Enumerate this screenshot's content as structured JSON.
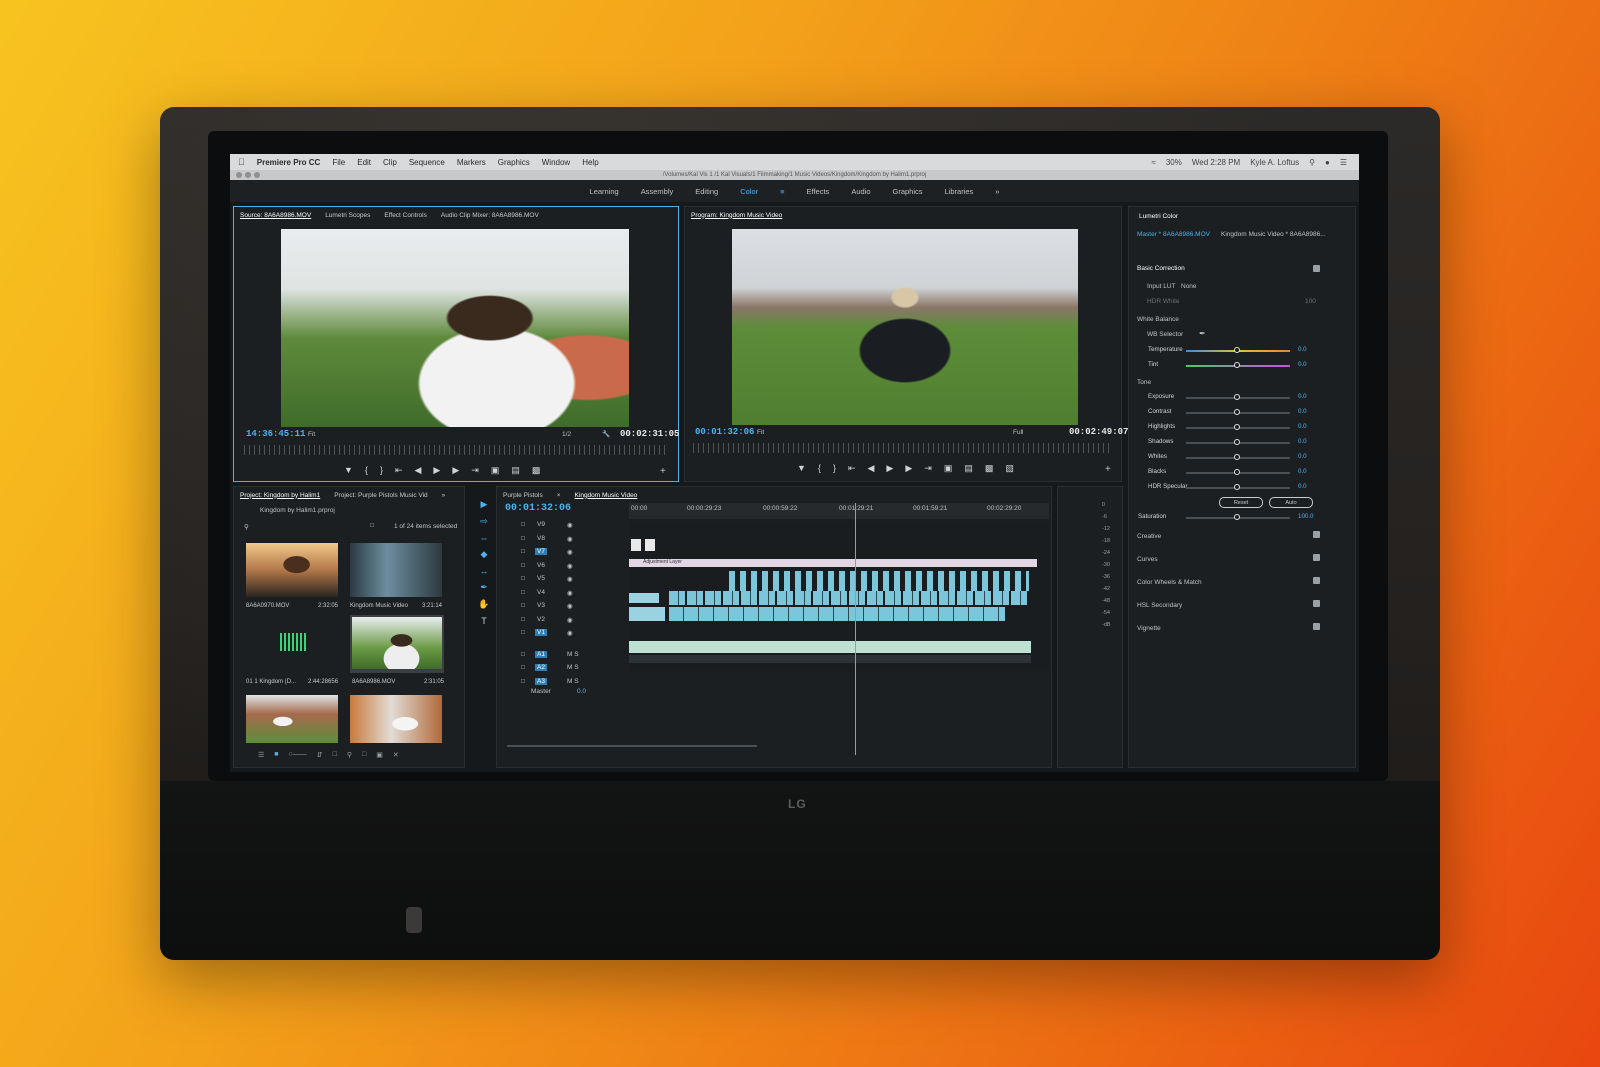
{
  "menubar": {
    "app": "Premiere Pro CC",
    "menus": [
      "File",
      "Edit",
      "Clip",
      "Sequence",
      "Markers",
      "Graphics",
      "Window",
      "Help"
    ],
    "datetime": "Wed 2:28 PM",
    "user": "Kyle A. Loftus",
    "battery": "30%"
  },
  "titlebar": {
    "path": "/Volumes/Kal Vis 1 /1 Kal Visuals/1 Filmmaking/1 Music Videos/Kingdom/Kingdom by Halim1.prproj"
  },
  "workspaces": [
    "Learning",
    "Assembly",
    "Editing",
    "Color",
    "Effects",
    "Audio",
    "Graphics",
    "Libraries"
  ],
  "workspace_active": "Color",
  "source": {
    "tabs": [
      "Source: 8A6A8986.MOV",
      "Lumetri Scopes",
      "Effect Controls",
      "Audio Clip Mixer: 8A6A8986.MOV"
    ],
    "timecode": "14:36:45:11",
    "fit": "Fit",
    "resolution": "1/2",
    "duration": "00:02:31:05"
  },
  "program": {
    "tab": "Program: Kingdom Music Video",
    "timecode": "00:01:32:06",
    "fit": "Fit",
    "resolution": "Full",
    "duration": "00:02:49:07"
  },
  "project": {
    "tabs": [
      "Project: Kingdom by Halim1",
      "Project: Purple Pistols Music Vid"
    ],
    "file": "Kingdom by Halim1.prproj",
    "selection": "1 of 24 items selected",
    "items": [
      {
        "name": "8A6A0970.MOV",
        "duration": "2:32:05"
      },
      {
        "name": "Kingdom Music Video",
        "duration": "3:21:14"
      },
      {
        "name": "01 1 Kingdom (D...",
        "duration": "2:44:28656"
      },
      {
        "name": "8A6A8986.MOV",
        "duration": "2:31:05"
      }
    ]
  },
  "timeline": {
    "tabs": [
      "Purple Pistols",
      "Kingdom Music Video"
    ],
    "timecode": "00:01:32:06",
    "ruler": [
      "00:00",
      "00:00:29:23",
      "00:00:59:22",
      "00:01:29:21",
      "00:01:59:21",
      "00:02:29:20"
    ],
    "video_tracks": [
      "V9",
      "V8",
      "V7",
      "V6",
      "V5",
      "V4",
      "V3",
      "V2",
      "V1"
    ],
    "audio_tracks": [
      "A1",
      "A2",
      "A3"
    ],
    "master": "Master",
    "master_value": "0.0",
    "adjustment_layer": "Adjustment Layer"
  },
  "meter_scale": [
    "0",
    "-6",
    "-12",
    "-18",
    "-24",
    "-30",
    "-36",
    "-42",
    "-48",
    "-54",
    "-dB"
  ],
  "lumetri": {
    "title": "Lumetri Color",
    "master": "Master * 8A6A8986.MOV",
    "sequence": "Kingdom Music Video * 8A6A8986...",
    "basic_correction": "Basic Correction",
    "input_lut": "Input LUT",
    "input_lut_value": "None",
    "hdr_white": "HDR White",
    "hdr_white_value": "100",
    "white_balance": "White Balance",
    "wb_selector": "WB Selector",
    "tone": "Tone",
    "saturation": "Saturation",
    "saturation_value": "100.0",
    "reset": "Reset",
    "auto": "Auto",
    "wb_sliders": [
      {
        "name": "Temperature",
        "value": "0.0"
      },
      {
        "name": "Tint",
        "value": "0.0"
      }
    ],
    "tone_sliders": [
      {
        "name": "Exposure",
        "value": "0.0"
      },
      {
        "name": "Contrast",
        "value": "0.0"
      },
      {
        "name": "Highlights",
        "value": "0.0"
      },
      {
        "name": "Shadows",
        "value": "0.0"
      },
      {
        "name": "Whites",
        "value": "0.0"
      },
      {
        "name": "Blacks",
        "value": "0.0"
      },
      {
        "name": "HDR Specular",
        "value": "0.0"
      }
    ],
    "sections": [
      "Creative",
      "Curves",
      "Color Wheels & Match",
      "HSL Secondary",
      "Vignette"
    ]
  },
  "monitor_brand": "LG",
  "colors": {
    "accent": "#4ab3f0",
    "clip": "#7bc6db",
    "background_orange": "#ee7a14"
  }
}
